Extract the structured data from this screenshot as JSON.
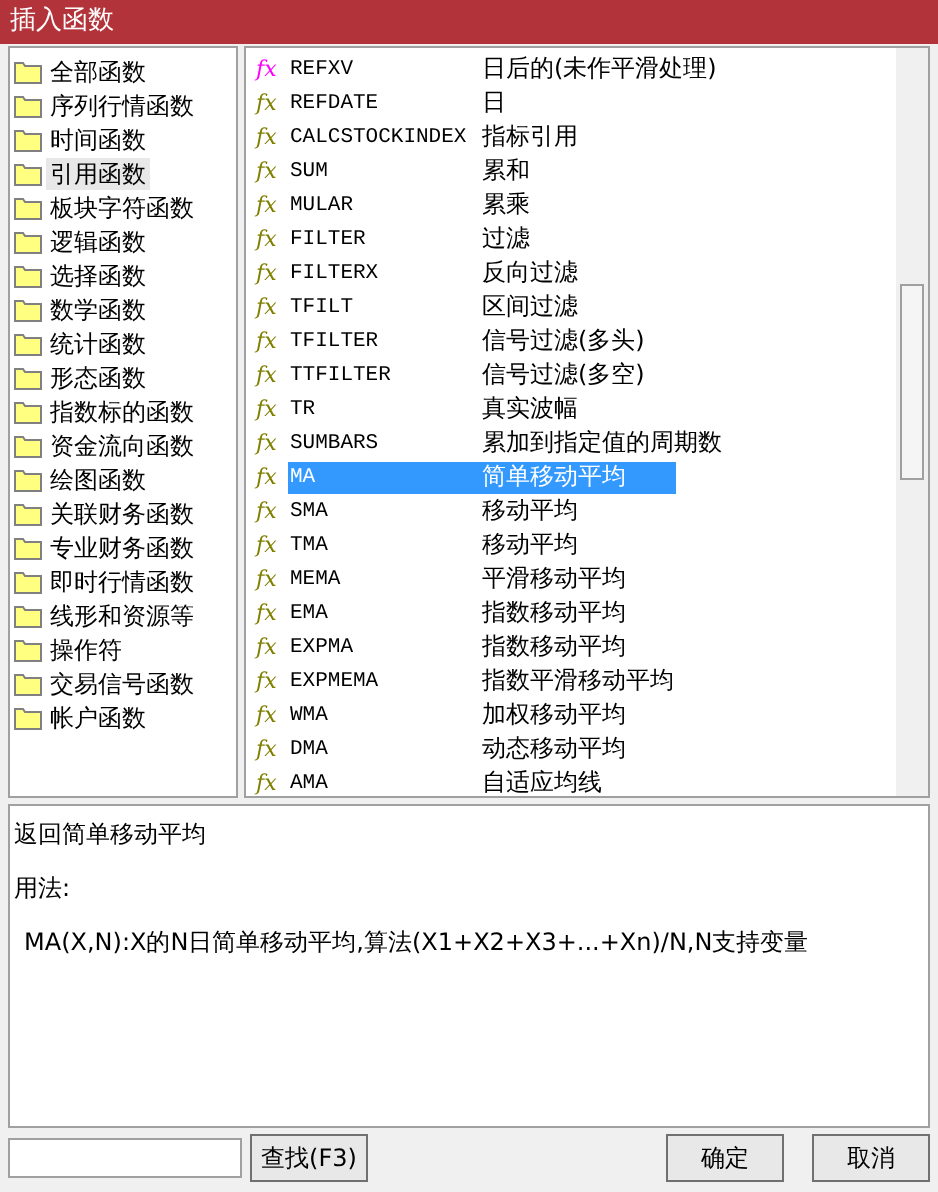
{
  "window": {
    "title": "插入函数"
  },
  "categories": [
    {
      "label": "全部函数",
      "selected": false
    },
    {
      "label": "序列行情函数",
      "selected": false
    },
    {
      "label": "时间函数",
      "selected": false
    },
    {
      "label": "引用函数",
      "selected": true
    },
    {
      "label": "板块字符函数",
      "selected": false
    },
    {
      "label": "逻辑函数",
      "selected": false
    },
    {
      "label": "选择函数",
      "selected": false
    },
    {
      "label": "数学函数",
      "selected": false
    },
    {
      "label": "统计函数",
      "selected": false
    },
    {
      "label": "形态函数",
      "selected": false
    },
    {
      "label": "指数标的函数",
      "selected": false
    },
    {
      "label": "资金流向函数",
      "selected": false
    },
    {
      "label": "绘图函数",
      "selected": false
    },
    {
      "label": "关联财务函数",
      "selected": false
    },
    {
      "label": "专业财务函数",
      "selected": false
    },
    {
      "label": "即时行情函数",
      "selected": false
    },
    {
      "label": "线形和资源等",
      "selected": false
    },
    {
      "label": "操作符",
      "selected": false
    },
    {
      "label": "交易信号函数",
      "selected": false
    },
    {
      "label": "帐户函数",
      "selected": false
    }
  ],
  "functions": [
    {
      "icon": "fx",
      "name": "REFXV",
      "description": "日后的(未作平滑处理)",
      "color": "#ff00ff",
      "selected": false
    },
    {
      "icon": "fx",
      "name": "REFDATE",
      "description": "日",
      "color": "#808000",
      "selected": false
    },
    {
      "icon": "fx",
      "name": "CALCSTOCKINDEX",
      "description": "指标引用",
      "color": "#808000",
      "selected": false
    },
    {
      "icon": "fx",
      "name": "SUM",
      "description": "累和",
      "color": "#808000",
      "selected": false
    },
    {
      "icon": "fx",
      "name": "MULAR",
      "description": "累乘",
      "color": "#808000",
      "selected": false
    },
    {
      "icon": "fx",
      "name": "FILTER",
      "description": "过滤",
      "color": "#808000",
      "selected": false
    },
    {
      "icon": "fx",
      "name": "FILTERX",
      "description": "反向过滤",
      "color": "#808000",
      "selected": false
    },
    {
      "icon": "fx",
      "name": "TFILT",
      "description": "区间过滤",
      "color": "#808000",
      "selected": false
    },
    {
      "icon": "fx",
      "name": "TFILTER",
      "description": "信号过滤(多头)",
      "color": "#808000",
      "selected": false
    },
    {
      "icon": "fx",
      "name": "TTFILTER",
      "description": "信号过滤(多空)",
      "color": "#808000",
      "selected": false
    },
    {
      "icon": "fx",
      "name": "TR",
      "description": "真实波幅",
      "color": "#808000",
      "selected": false
    },
    {
      "icon": "fx",
      "name": "SUMBARS",
      "description": "累加到指定值的周期数",
      "color": "#808000",
      "selected": false
    },
    {
      "icon": "fx",
      "name": "MA",
      "description": "简单移动平均",
      "color": "#808000",
      "selected": true
    },
    {
      "icon": "fx",
      "name": "SMA",
      "description": "移动平均",
      "color": "#808000",
      "selected": false
    },
    {
      "icon": "fx",
      "name": "TMA",
      "description": "移动平均",
      "color": "#808000",
      "selected": false
    },
    {
      "icon": "fx",
      "name": "MEMA",
      "description": "平滑移动平均",
      "color": "#808000",
      "selected": false
    },
    {
      "icon": "fx",
      "name": "EMA",
      "description": "指数移动平均",
      "color": "#808000",
      "selected": false
    },
    {
      "icon": "fx",
      "name": "EXPMA",
      "description": "指数移动平均",
      "color": "#808000",
      "selected": false
    },
    {
      "icon": "fx",
      "name": "EXPMEMA",
      "description": "指数平滑移动平均",
      "color": "#808000",
      "selected": false
    },
    {
      "icon": "fx",
      "name": "WMA",
      "description": "加权移动平均",
      "color": "#808000",
      "selected": false
    },
    {
      "icon": "fx",
      "name": "DMA",
      "description": "动态移动平均",
      "color": "#808000",
      "selected": false
    },
    {
      "icon": "fx",
      "name": "AMA",
      "description": "自适应均线",
      "color": "#808000",
      "selected": false
    }
  ],
  "help": {
    "summary": "返回简单移动平均",
    "usage_label": "用法:",
    "usage": "MA(X,N):X的N日简单移动平均,算法(X1+X2+X3+...+Xn)/N,N支持变量"
  },
  "search": {
    "button": "查找(F3)"
  },
  "buttons": [
    "确定",
    "取消"
  ]
}
